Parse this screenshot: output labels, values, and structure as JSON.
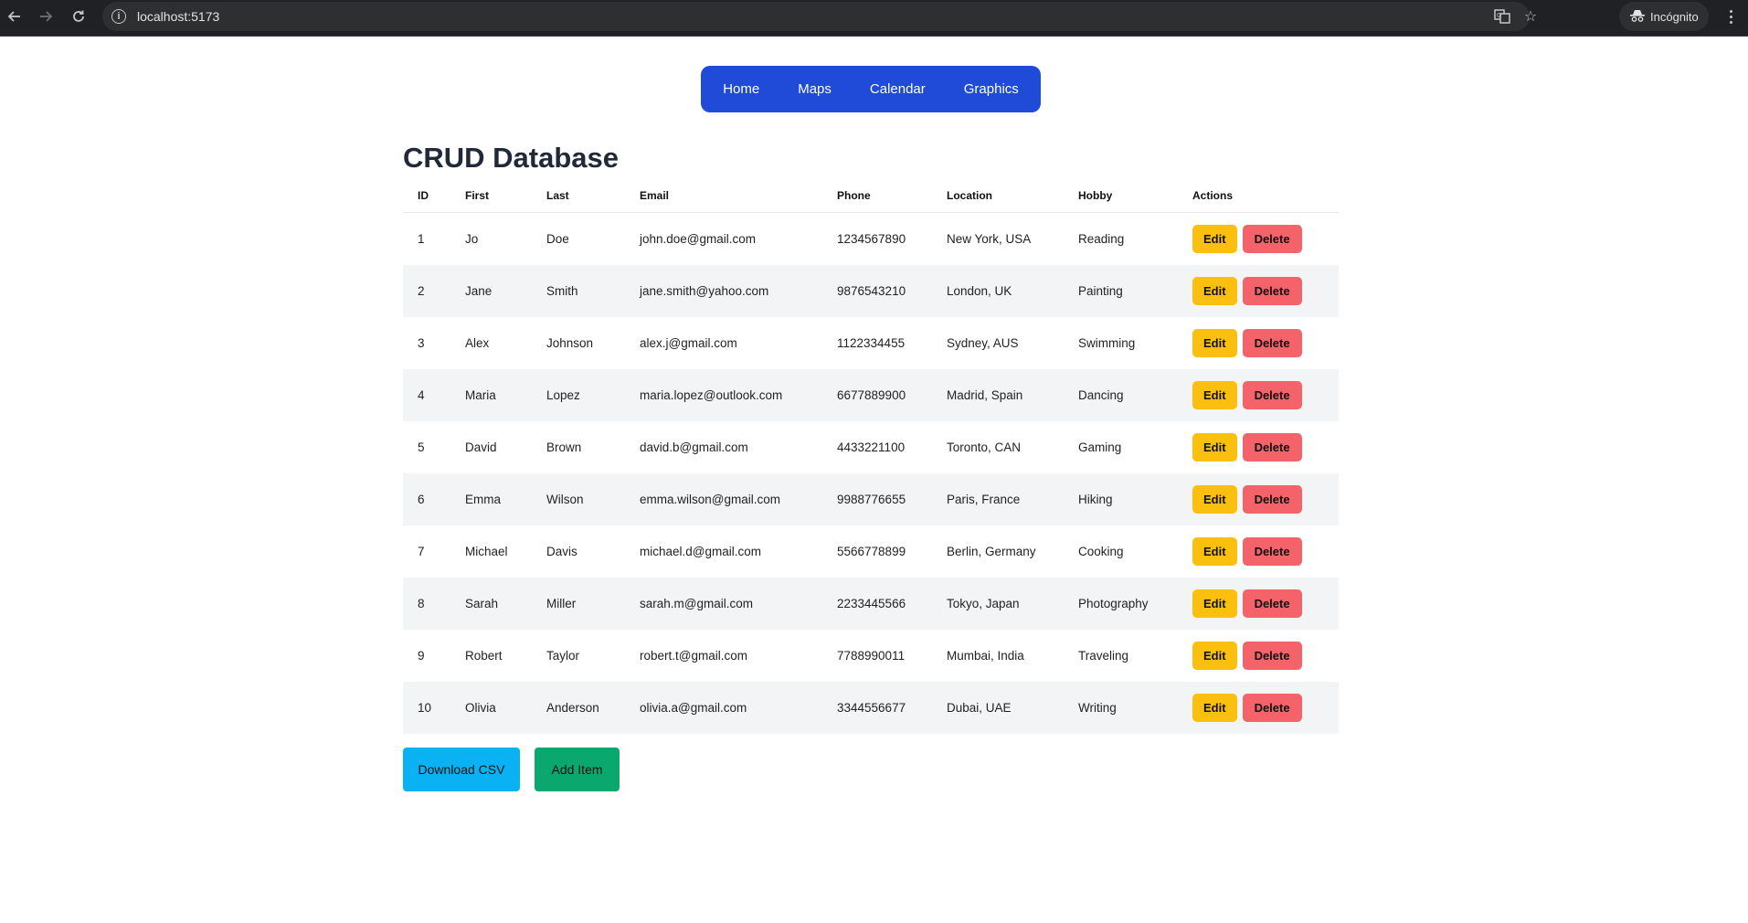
{
  "browser": {
    "url": "localhost:5173",
    "incognito_label": "Incógnito",
    "icons": {
      "back": "arrow-left-icon",
      "forward": "arrow-right-icon",
      "reload": "reload-icon",
      "site_info": "info-icon",
      "translate": "translate-icon",
      "bookmark": "star-icon",
      "incognito": "incognito-icon",
      "menu": "kebab-menu-icon"
    }
  },
  "nav": {
    "items": [
      {
        "label": "Home"
      },
      {
        "label": "Maps"
      },
      {
        "label": "Calendar"
      },
      {
        "label": "Graphics"
      }
    ]
  },
  "page": {
    "title": "CRUD Database"
  },
  "table": {
    "headers": {
      "id": "ID",
      "first": "First",
      "last": "Last",
      "email": "Email",
      "phone": "Phone",
      "location": "Location",
      "hobby": "Hobby",
      "actions": "Actions"
    },
    "edit_label": "Edit",
    "delete_label": "Delete",
    "rows": [
      {
        "id": "1",
        "first": "Jo",
        "last": "Doe",
        "email": "john.doe@gmail.com",
        "phone": "1234567890",
        "location": "New York, USA",
        "hobby": "Reading"
      },
      {
        "id": "2",
        "first": "Jane",
        "last": "Smith",
        "email": "jane.smith@yahoo.com",
        "phone": "9876543210",
        "location": "London, UK",
        "hobby": "Painting"
      },
      {
        "id": "3",
        "first": "Alex",
        "last": "Johnson",
        "email": "alex.j@gmail.com",
        "phone": "1122334455",
        "location": "Sydney, AUS",
        "hobby": "Swimming"
      },
      {
        "id": "4",
        "first": "Maria",
        "last": "Lopez",
        "email": "maria.lopez@outlook.com",
        "phone": "6677889900",
        "location": "Madrid, Spain",
        "hobby": "Dancing"
      },
      {
        "id": "5",
        "first": "David",
        "last": "Brown",
        "email": "david.b@gmail.com",
        "phone": "4433221100",
        "location": "Toronto, CAN",
        "hobby": "Gaming"
      },
      {
        "id": "6",
        "first": "Emma",
        "last": "Wilson",
        "email": "emma.wilson@gmail.com",
        "phone": "9988776655",
        "location": "Paris, France",
        "hobby": "Hiking"
      },
      {
        "id": "7",
        "first": "Michael",
        "last": "Davis",
        "email": "michael.d@gmail.com",
        "phone": "5566778899",
        "location": "Berlin, Germany",
        "hobby": "Cooking"
      },
      {
        "id": "8",
        "first": "Sarah",
        "last": "Miller",
        "email": "sarah.m@gmail.com",
        "phone": "2233445566",
        "location": "Tokyo, Japan",
        "hobby": "Photography"
      },
      {
        "id": "9",
        "first": "Robert",
        "last": "Taylor",
        "email": "robert.t@gmail.com",
        "phone": "7788990011",
        "location": "Mumbai, India",
        "hobby": "Traveling"
      },
      {
        "id": "10",
        "first": "Olivia",
        "last": "Anderson",
        "email": "olivia.a@gmail.com",
        "phone": "3344556677",
        "location": "Dubai, UAE",
        "hobby": "Writing"
      }
    ]
  },
  "actions": {
    "download_csv": "Download CSV",
    "add_item": "Add Item"
  },
  "colors": {
    "nav_bg": "#1f4bd8",
    "edit_button": "#fbbf0f",
    "delete_button": "#f4626a",
    "download_button": "#0ab2f3",
    "add_button": "#0aa86f",
    "stripe": "#f3f4f6"
  }
}
